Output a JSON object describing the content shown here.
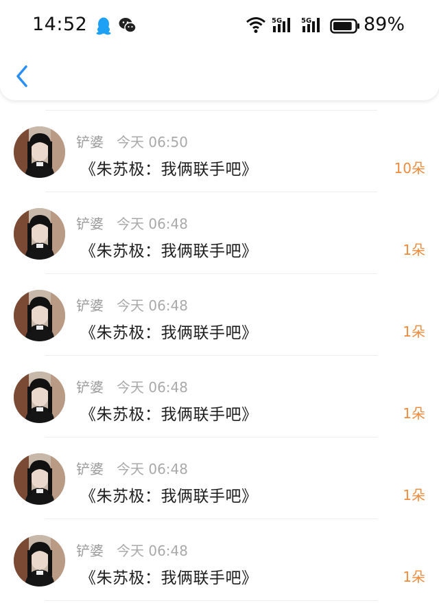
{
  "status_bar": {
    "time": "14:52",
    "battery_text": "89%",
    "battery_level": 0.89,
    "network_1": "5G",
    "network_2": "5G",
    "app_icons": [
      "qq-icon",
      "wechat-icon"
    ],
    "system_icons": [
      "wifi-icon",
      "signal-5g-icon",
      "signal-5g-icon",
      "battery-icon"
    ]
  },
  "header": {
    "back_icon": "chevron-left-icon",
    "accent_color": "#2a8ff7"
  },
  "items": [
    {
      "name": "铲婆",
      "time": "今天 06:50",
      "message": "《朱苏极：我俩联手吧》",
      "count": "10朵"
    },
    {
      "name": "铲婆",
      "time": "今天 06:48",
      "message": "《朱苏极：我俩联手吧》",
      "count": "1朵"
    },
    {
      "name": "铲婆",
      "time": "今天 06:48",
      "message": "《朱苏极：我俩联手吧》",
      "count": "1朵"
    },
    {
      "name": "铲婆",
      "time": "今天 06:48",
      "message": "《朱苏极：我俩联手吧》",
      "count": "1朵"
    },
    {
      "name": "铲婆",
      "time": "今天 06:48",
      "message": "《朱苏极：我俩联手吧》",
      "count": "1朵"
    },
    {
      "name": "铲婆",
      "time": "今天 06:48",
      "message": "《朱苏极：我俩联手吧》",
      "count": "1朵"
    }
  ],
  "colors": {
    "count_orange": "#f08a3c",
    "meta_gray": "#9a9a9a"
  }
}
